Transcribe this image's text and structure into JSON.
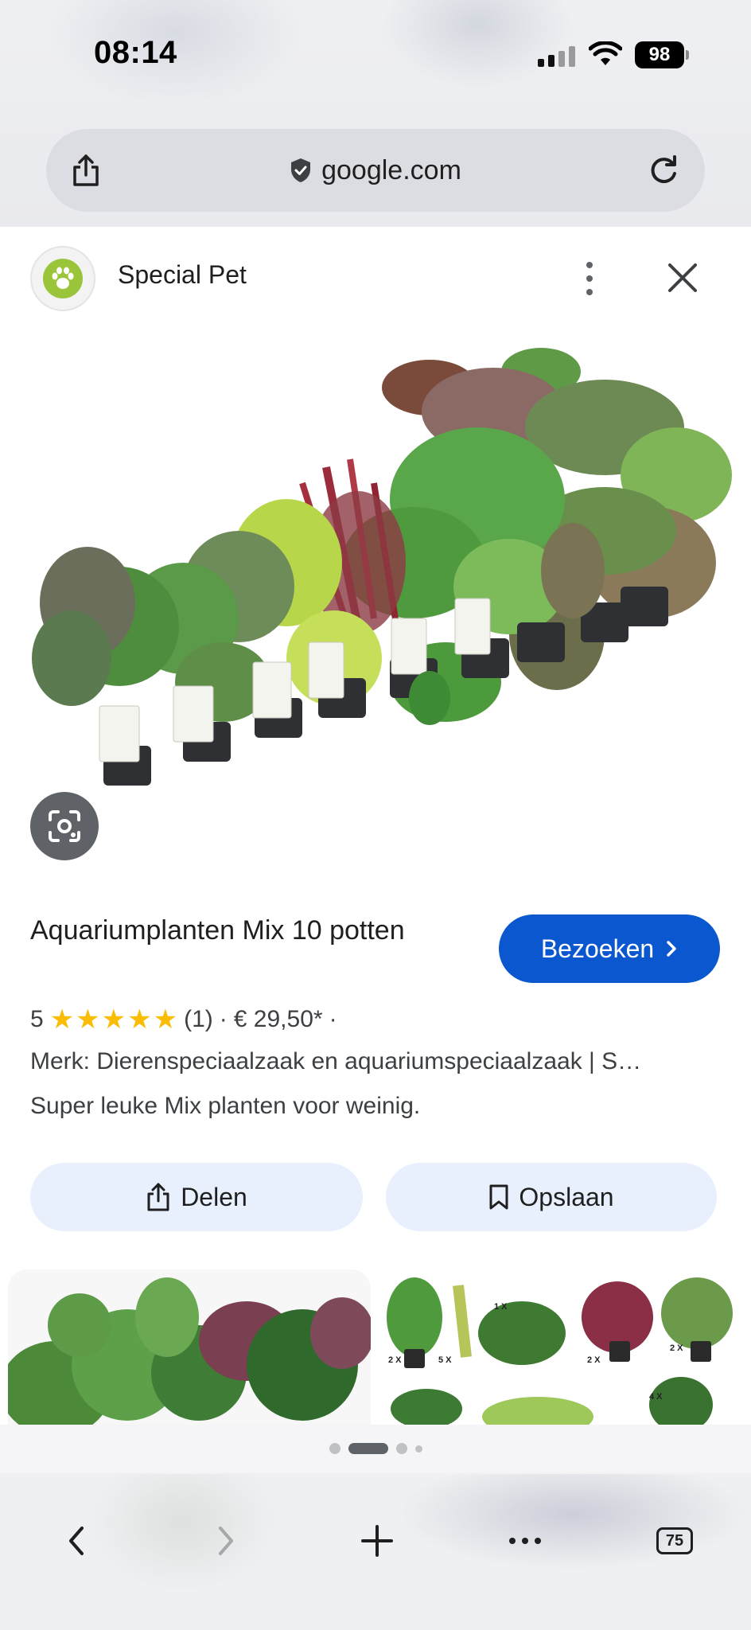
{
  "status_bar": {
    "time": "08:14",
    "battery": "98"
  },
  "browser": {
    "url": "google.com",
    "tabs_count": "75"
  },
  "sheet": {
    "site_name": "Special Pet",
    "product": {
      "title": "Aquariumplanten Mix 10 potten",
      "visit_label": "Bezoeken",
      "rating_value": "5",
      "stars": 5,
      "review_count": "(1)",
      "price": "€ 29,50*",
      "brand_line": "Merk: Dierenspeciaalzaak en aquariumspeciaalzaak | S…",
      "description": "Super leuke Mix planten voor weinig."
    },
    "actions": {
      "share_label": "Delen",
      "save_label": "Opslaan"
    },
    "related_thumb_labels": [
      "2 X",
      "5 X",
      "1 X",
      "2 X",
      "2 X",
      "4 X"
    ]
  },
  "colors": {
    "primary": "#0b57d0",
    "action_bg": "#e8f0fe",
    "star": "#fbbc04",
    "logo": "#9ac43a"
  },
  "icons": [
    "share-icon",
    "shield-icon",
    "reload-icon",
    "more-vert-icon",
    "close-icon",
    "lens-icon",
    "chevron-right-icon",
    "bookmark-icon",
    "back-icon",
    "forward-icon",
    "plus-icon",
    "ellipsis-icon"
  ]
}
